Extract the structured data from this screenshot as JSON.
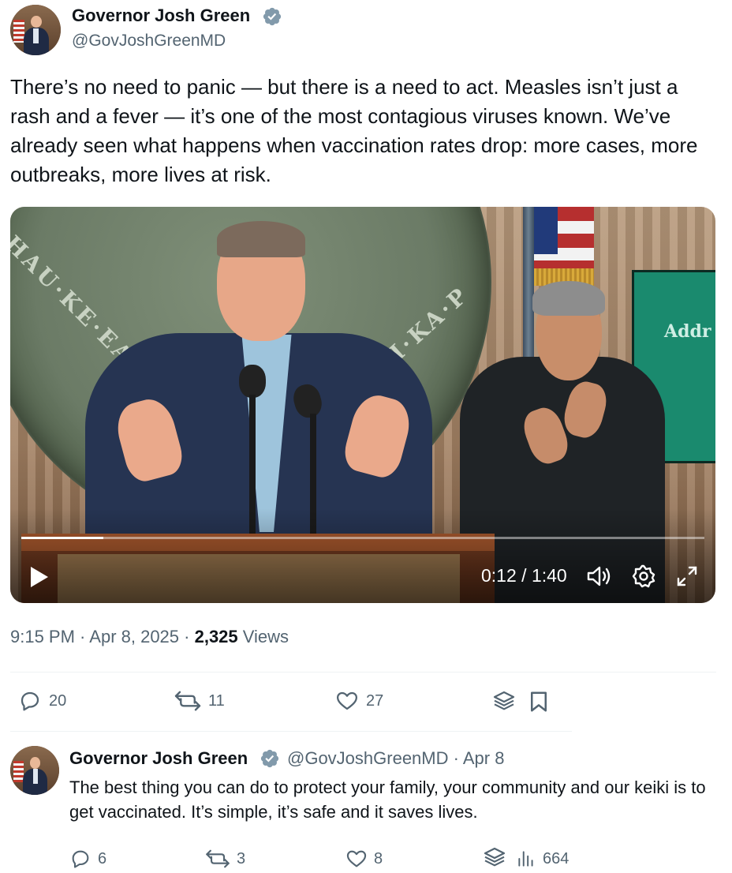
{
  "colors": {
    "text_primary": "#0f1419",
    "text_secondary": "#536471",
    "verified_badge": "#829aab",
    "divider": "#eff3f4"
  },
  "tweet": {
    "author": {
      "name": "Governor Josh Green",
      "handle": "@GovJoshGreenMD",
      "verified_icon": "verified-badge-icon",
      "avatar_icon": "avatar"
    },
    "text": "There’s no need to panic — but there is a need to act. Measles isn’t just a rash and a fever — it’s one of the most contagious viruses known. We’ve already seen what happens when vaccination rates drop: more cases, more outbreaks, more lives at risk.",
    "video": {
      "seal_text_left": "HAU·KE·EA·O",
      "seal_text_right": "INA·I·KA·P",
      "screen_text": "Addr",
      "current_time": "0:12",
      "separator": " / ",
      "duration": "1:40",
      "progress_fraction": 0.12,
      "controls": [
        "play-icon",
        "volume-icon",
        "settings-icon",
        "fullscreen-icon"
      ]
    },
    "meta": {
      "time": "9:15 PM",
      "dot1": " · ",
      "date": "Apr 8, 2025",
      "dot2": " · ",
      "views_count": "2,325",
      "views_label": " Views"
    },
    "actions": {
      "replies": "20",
      "reposts": "11",
      "likes": "27"
    }
  },
  "reply": {
    "author": {
      "name": "Governor Josh Green",
      "handle_date": "@GovJoshGreenMD · Apr 8"
    },
    "text": "The best thing you can do to protect your family, your community and our keiki is to get vaccinated. It’s simple, it’s safe and it saves lives.",
    "actions": {
      "replies": "6",
      "reposts": "3",
      "likes": "8",
      "views": "664"
    }
  }
}
